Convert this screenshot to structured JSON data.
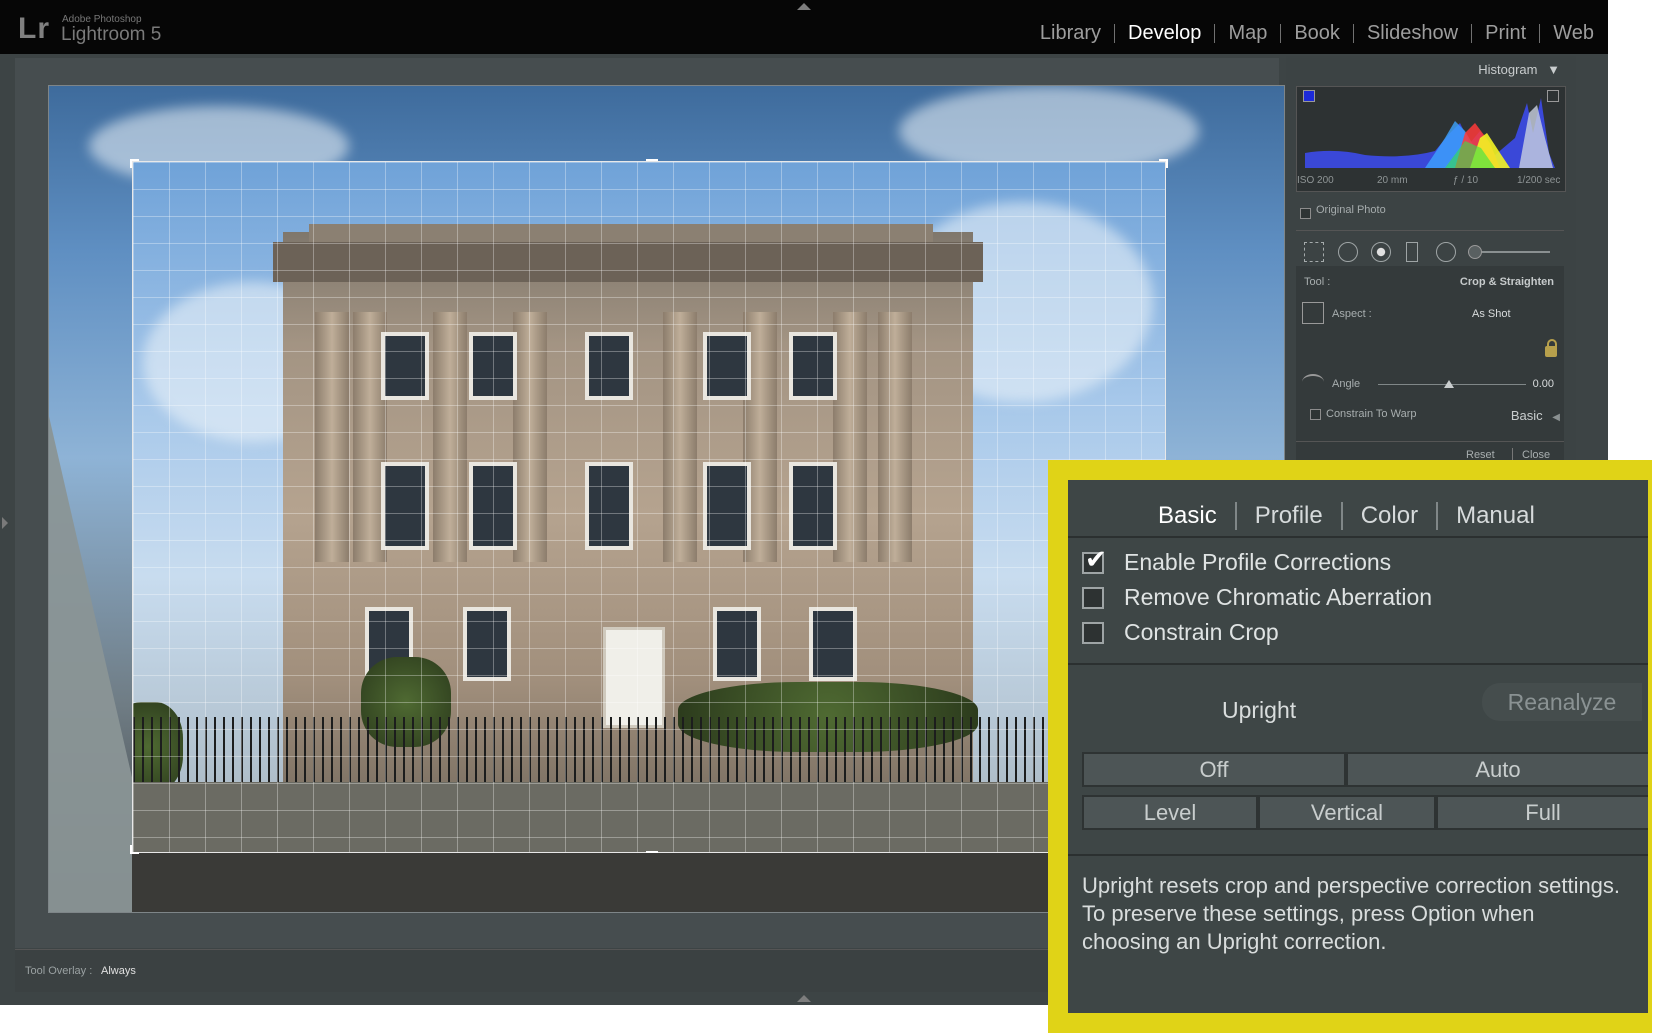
{
  "app": {
    "logo": "Lr",
    "brand_small": "Adobe Photoshop",
    "brand_name": "Lightroom 5"
  },
  "modules": [
    "Library",
    "Develop",
    "Map",
    "Book",
    "Slideshow",
    "Print",
    "Web"
  ],
  "active_module": "Develop",
  "toolbar": {
    "tool_overlay_label": "Tool Overlay :",
    "tool_overlay_value": "Always"
  },
  "histogram": {
    "title": "Histogram",
    "iso": "ISO 200",
    "focal": "20 mm",
    "aperture": "ƒ / 10",
    "shutter": "1/200 sec",
    "original_photo": "Original Photo"
  },
  "crop_tool": {
    "tool_label": "Tool :",
    "tool_value": "Crop & Straighten",
    "aspect_label": "Aspect :",
    "aspect_value": "As Shot",
    "angle_label": "Angle",
    "angle_value": "0.00",
    "constrain_warp": "Constrain To Warp",
    "reset": "Reset",
    "close": "Close"
  },
  "basic_header": "Basic",
  "lens_panel": {
    "tabs": [
      "Basic",
      "Profile",
      "Color",
      "Manual"
    ],
    "active_tab": "Basic",
    "checkboxes": [
      {
        "label": "Enable Profile Corrections",
        "checked": true
      },
      {
        "label": "Remove Chromatic Aberration",
        "checked": false
      },
      {
        "label": "Constrain Crop",
        "checked": false
      }
    ],
    "upright_label": "Upright",
    "reanalyze": "Reanalyze",
    "buttons_row1": [
      "Off",
      "Auto"
    ],
    "buttons_row2": [
      "Level",
      "Vertical",
      "Full"
    ],
    "help_text": "Upright resets crop and perspective correction settings. To preserve these settings, press Option when choosing an Upright correction."
  },
  "colors": {
    "highlight_frame": "#e0d317",
    "panel_bg": "#3e4646",
    "app_bg": "#3d4445"
  }
}
